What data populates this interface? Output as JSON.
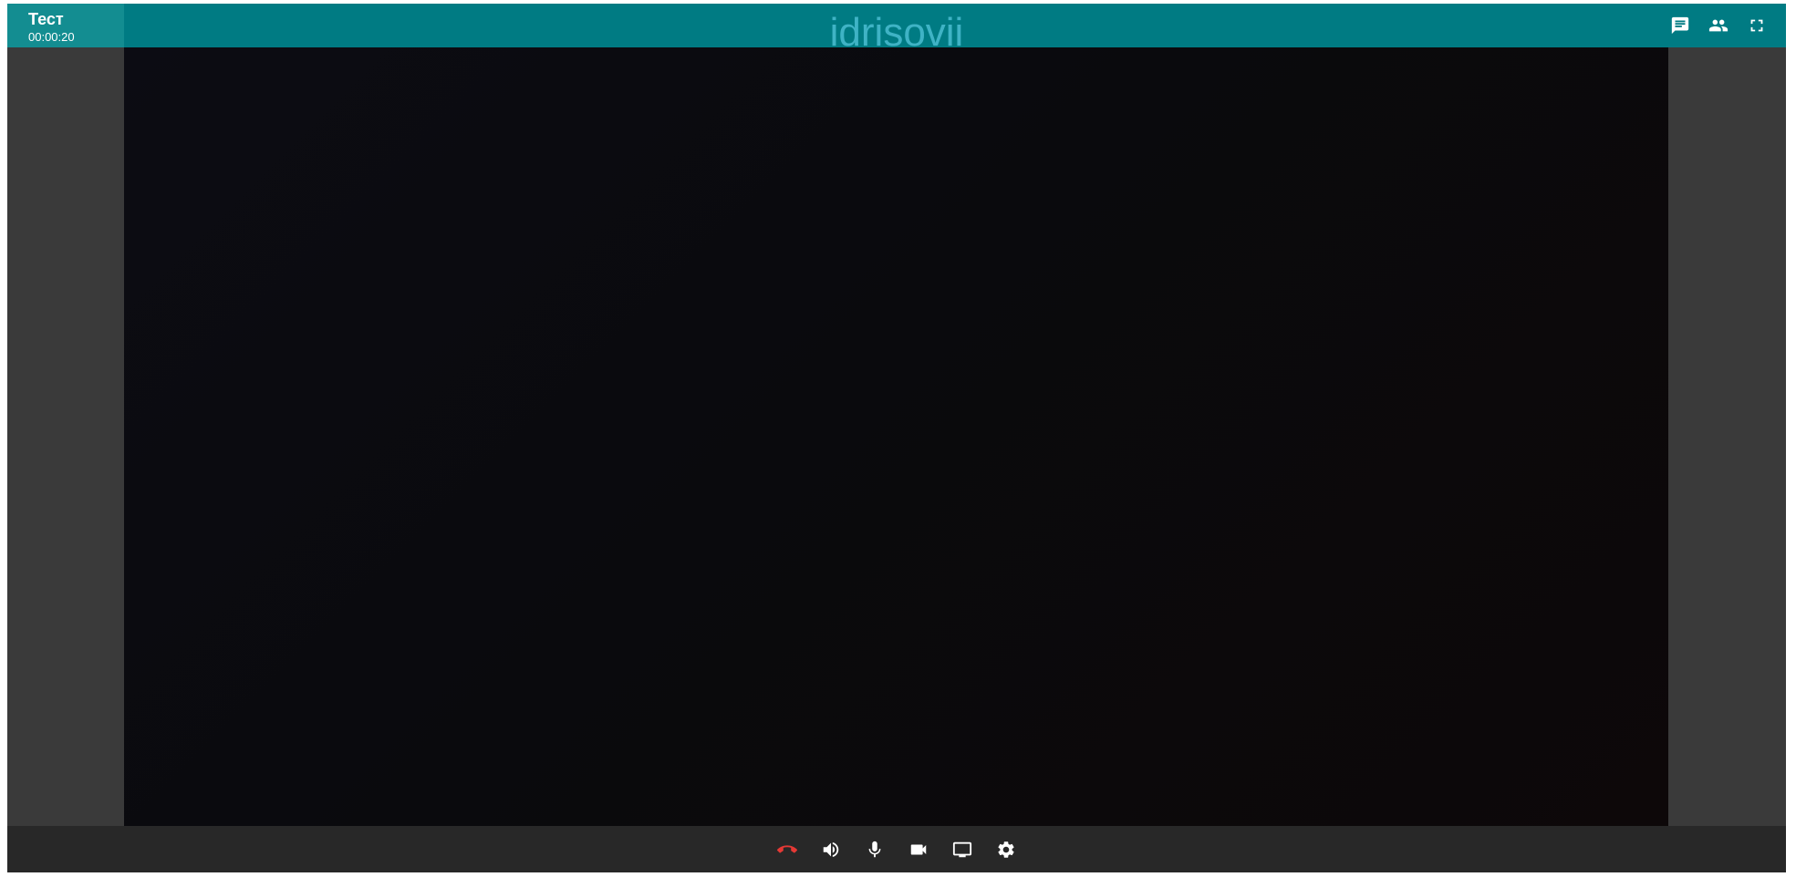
{
  "header": {
    "room_title": "Тест",
    "call_timer": "00:00:20",
    "participant_name": "idrisovii",
    "actions": [
      {
        "name": "chat-icon"
      },
      {
        "name": "participants-icon"
      },
      {
        "name": "fullscreen-icon"
      }
    ]
  },
  "toolbar": {
    "buttons": [
      {
        "name": "hangup-icon",
        "color": "#e53935"
      },
      {
        "name": "volume-icon"
      },
      {
        "name": "microphone-icon"
      },
      {
        "name": "camera-icon"
      },
      {
        "name": "screen-share-icon"
      },
      {
        "name": "settings-icon"
      }
    ]
  },
  "colors": {
    "header_bg": "#007b83",
    "header_left_block": "#138d91",
    "participant_name": "#3fb3c5",
    "app_bg": "#3a3a3a",
    "toolbar_bg": "#282828",
    "video_bg": "#0a0a0d",
    "hangup": "#e53935"
  }
}
